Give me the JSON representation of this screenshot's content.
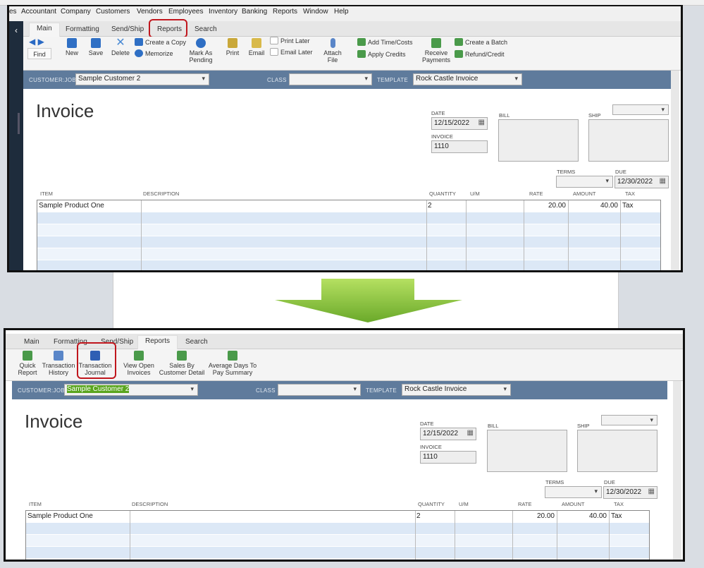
{
  "menu": [
    "es",
    "Accountant",
    "Company",
    "Customers",
    "Vendors",
    "Employees",
    "Inventory",
    "Banking",
    "Reports",
    "Window",
    "Help"
  ],
  "tabs": [
    "Main",
    "Formatting",
    "Send/Ship",
    "Reports",
    "Search"
  ],
  "main_ribbon": {
    "find": "Find",
    "new": "New",
    "save": "Save",
    "delete": "Delete",
    "create_copy": "Create a Copy",
    "memorize": "Memorize",
    "mark_pending": "Mark As Pending",
    "print": "Print",
    "email": "Email",
    "print_later": "Print Later",
    "email_later": "Email Later",
    "attach": "Attach File",
    "add_time": "Add Time/Costs",
    "apply_credits": "Apply Credits",
    "receive": "Receive Payments",
    "create_batch": "Create a Batch",
    "refund": "Refund/Credit"
  },
  "reports_ribbon": {
    "quick": "Quick Report",
    "history": "Transaction History",
    "journal": "Transaction Journal",
    "open_invoices": "View Open Invoices",
    "sales_by": "Sales By Customer Detail",
    "avg_days": "Average Days To Pay Summary"
  },
  "invoice": {
    "customer_label": "CUSTOMER:JOB",
    "customer": "Sample Customer 2",
    "class_label": "CLASS",
    "template_label": "TEMPLATE",
    "template": "Rock Castle Invoice",
    "title": "Invoice",
    "date_label": "DATE",
    "date": "12/15/2022",
    "invoice_no_label": "INVOICE #",
    "invoice_no": "1110",
    "bill_to": "BILL TO",
    "ship_to": "SHIP TO",
    "terms": "TERMS",
    "due_label": "DUE DATE",
    "due": "12/30/2022",
    "columns": [
      "ITEM",
      "DESCRIPTION",
      "QUANTITY",
      "U/M",
      "RATE",
      "AMOUNT",
      "TAX"
    ],
    "line": {
      "item": "Sample Product One",
      "qty": "2",
      "rate": "20.00",
      "amount": "40.00",
      "tax": "Tax"
    }
  },
  "colors": {
    "highlight": "#c0161d",
    "bar": "#5f7b9c",
    "arrow": "#8cc63f"
  }
}
